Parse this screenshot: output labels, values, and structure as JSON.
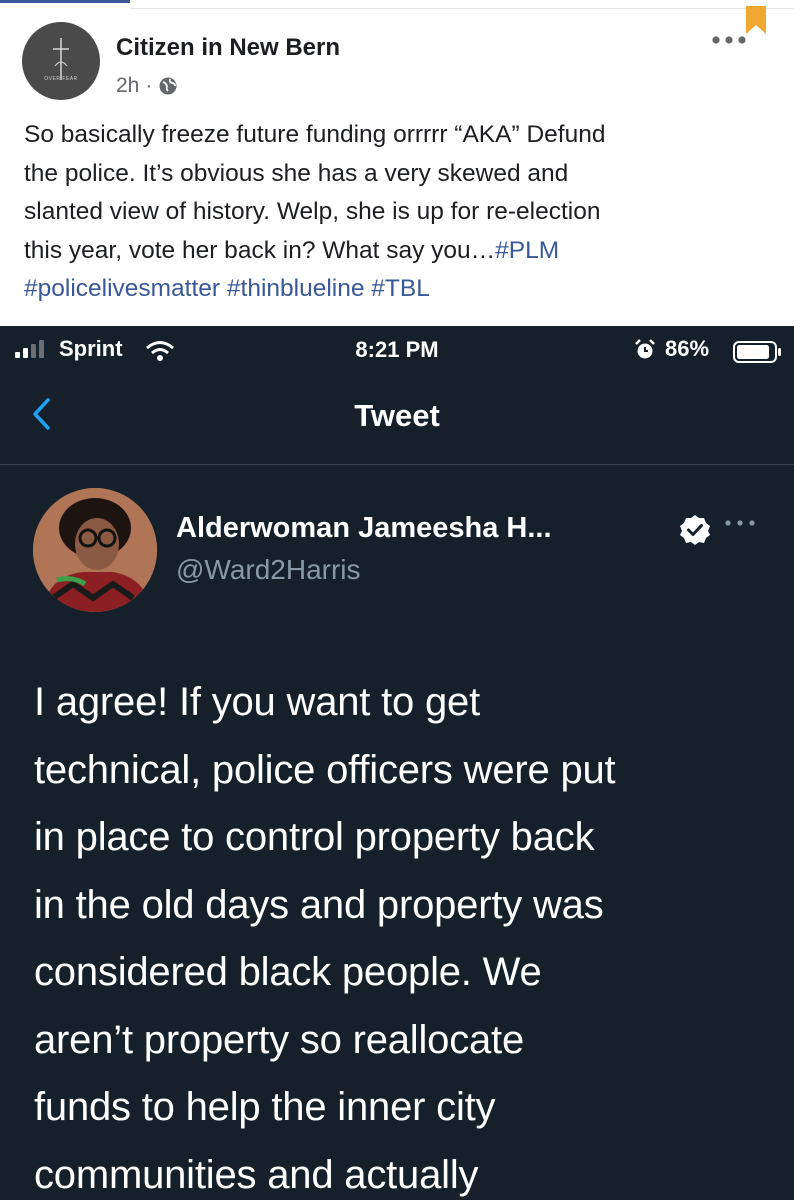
{
  "facebook_post": {
    "author": "Citizen in New Bern",
    "avatar_caption": "OVER FEAR",
    "time": "2h",
    "separator": "·",
    "text_lines": [
      "So basically freeze future funding orrrrr “AKA” Defund",
      "the police. It’s obvious she has a very skewed and",
      "slanted view of history. Welp, she is up for re-election"
    ],
    "line4_text": "this year, vote her back in? What say you…",
    "hashtags_line4": "#PLM",
    "hashtags_line5": "#policelivesmatter #thinblueline #TBL"
  },
  "phone_status": {
    "carrier": "Sprint",
    "time": "8:21 PM",
    "battery_percent": "86%"
  },
  "tweet": {
    "nav_title": "Tweet",
    "display_name": "Alderwoman Jameesha H...",
    "handle": "@Ward2Harris",
    "body_lines": [
      "I agree! If you want to get",
      "technical, police officers were put",
      "in place to control property back",
      "in the old days and property was",
      "considered black people. We",
      "aren’t property so reallocate",
      "funds to help the inner city",
      "communities and actually"
    ]
  },
  "colors": {
    "facebook_link": "#385898",
    "tweet_background": "#15202b",
    "twitter_blue": "#1da1f2",
    "bookmark": "#f0a830"
  }
}
